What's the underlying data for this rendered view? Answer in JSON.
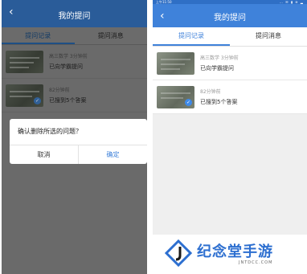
{
  "left_screen": {
    "header": {
      "back_icon": "chevron-left-icon",
      "title": "我的提问"
    },
    "tabs": [
      {
        "label": "提问记录",
        "active": true
      },
      {
        "label": "提问消息",
        "active": false
      }
    ],
    "items": [
      {
        "meta": "高三数学 3分钟前",
        "desc": "已向学霸提问",
        "answered": false
      },
      {
        "meta": "82分钟前",
        "desc": "已搜到5个答案",
        "answered": true
      }
    ],
    "dialog": {
      "message": "确认删除所选的问题？",
      "cancel": "取消",
      "confirm": "确定"
    }
  },
  "right_screen": {
    "status_bar": {
      "time": "上午11:50",
      "icons": "… ✉ ▮ ≋ ▂"
    },
    "header": {
      "back_icon": "chevron-left-icon",
      "title": "我的提问"
    },
    "tabs": [
      {
        "label": "提问记录",
        "active": true
      },
      {
        "label": "提问消息",
        "active": false
      }
    ],
    "items": [
      {
        "meta": "高三数学 3分钟前",
        "desc": "已向学霸提问",
        "answered": false
      },
      {
        "meta": "82分钟前",
        "desc": "已搜到5个答案",
        "answered": true
      }
    ]
  },
  "watermark": {
    "name": "纪念堂手游",
    "domain": "JNTDCC.COM"
  },
  "colors": {
    "accent": "#3f82da",
    "header_dim": "#2a5c99",
    "overlay": "#6a6a6a",
    "watermark_blue": "#2d6fd0"
  }
}
